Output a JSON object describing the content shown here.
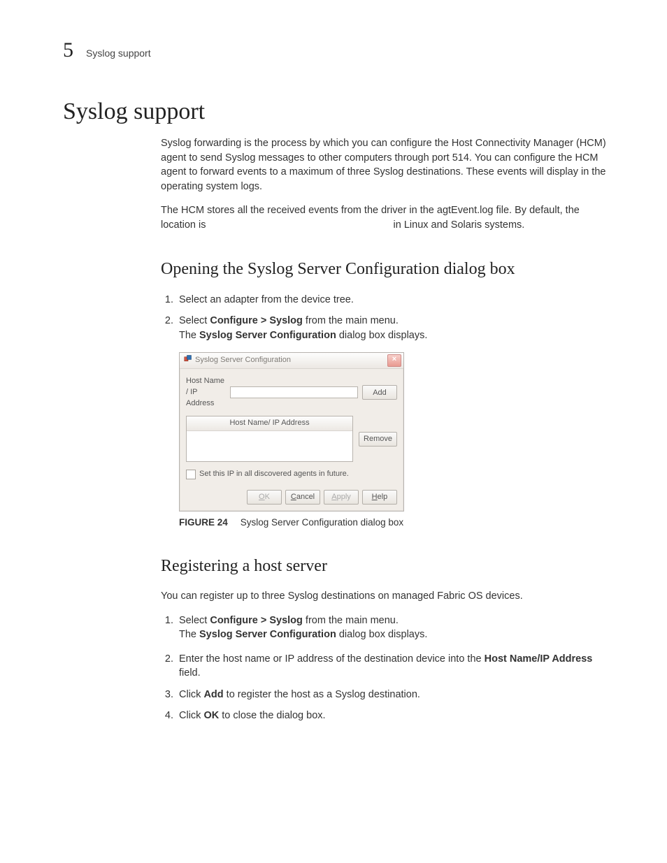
{
  "header": {
    "chapter_number": "5",
    "chapter_title": "Syslog support"
  },
  "main_title": "Syslog support",
  "intro": {
    "p1": "Syslog forwarding is the process by which you can configure the Host Connectivity Manager (HCM) agent to send Syslog messages to other computers through port 514. You can configure the HCM agent to forward events to a maximum of three Syslog destinations. These events will display in the operating system logs.",
    "p2_a": "The HCM stores all the received events from the driver in the agtEvent.log file. By default, the location is",
    "p2_b": "in Linux and Solaris systems."
  },
  "section_open": {
    "title": "Opening the Syslog Server Configuration dialog box",
    "step1": "Select an adapter from the device tree.",
    "step2_pre": "Select ",
    "step2_bold": "Configure > Syslog",
    "step2_post": " from the main menu.",
    "step2_desc_pre": "The ",
    "step2_desc_bold": "Syslog Server Configuration",
    "step2_desc_post": " dialog box displays."
  },
  "dialog": {
    "title": "Syslog Server Configuration",
    "host_label": "Host Name / IP Address",
    "add": "Add",
    "list_header": "Host Name/ IP Address",
    "remove": "Remove",
    "checkbox_label": "Set this IP in all discovered agents in future.",
    "ok": "OK",
    "ok_u": "O",
    "ok_rest": "K",
    "cancel_u": "C",
    "cancel_rest": "ancel",
    "apply_u": "A",
    "apply_rest": "pply",
    "help_u": "H",
    "help_rest": "elp"
  },
  "figure": {
    "label": "FIGURE 24",
    "caption": "Syslog Server Configuration dialog box"
  },
  "section_register": {
    "title": "Registering a host server",
    "intro": "You can register up to three Syslog destinations on managed Fabric OS devices.",
    "step1_pre": "Select ",
    "step1_bold": "Configure > Syslog",
    "step1_post": " from the main menu.",
    "step1_desc_pre": "The ",
    "step1_desc_bold": "Syslog Server Configuration",
    "step1_desc_post": " dialog box displays.",
    "step2_pre": "Enter the host name or IP address of the destination device into the ",
    "step2_bold": "Host Name/IP Address",
    "step2_post": " field.",
    "step3_pre": "Click ",
    "step3_bold": "Add",
    "step3_post": " to register the host as a Syslog destination.",
    "step4_pre": "Click ",
    "step4_bold": "OK",
    "step4_post": " to close the dialog box."
  }
}
